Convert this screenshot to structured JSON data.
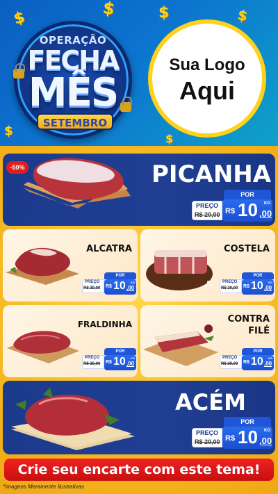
{
  "header": {
    "badge": {
      "line1": "OPERAÇÃO",
      "line2": "FECHA",
      "line3": "MÊS",
      "month": "SETEMBRO"
    },
    "logo": {
      "line1": "Sua Logo",
      "line2": "Aqui"
    },
    "decor_icon": "dollar-sign"
  },
  "colors": {
    "header_blue": "#0a5fc0",
    "card_blue": "#1c3a8c",
    "price_blue": "#1e56d6",
    "accent_yellow": "#ffd21a",
    "cta_red": "#e01e1e"
  },
  "products": [
    {
      "name": "PICANHA",
      "badge": "-50%",
      "por": "POR",
      "preco": "PREÇO",
      "old_price": "R$ 20,00",
      "currency": "R$",
      "price": "10",
      "cents": ",00",
      "unit": "KG"
    },
    {
      "name": "ALCATRA",
      "por": "POR",
      "preco": "PREÇO",
      "old_price": "R$ 20,00",
      "currency": "R$",
      "price": "10",
      "cents": ",00",
      "unit": "KG"
    },
    {
      "name": "COSTELA",
      "por": "POR",
      "preco": "PREÇO",
      "old_price": "R$ 20,00",
      "currency": "R$",
      "price": "10",
      "cents": ",00",
      "unit": "KG"
    },
    {
      "name": "FRALDINHA",
      "por": "POR",
      "preco": "PREÇO",
      "old_price": "R$ 20,00",
      "currency": "R$",
      "price": "10",
      "cents": ",00",
      "unit": "KG"
    },
    {
      "name_line1": "CONTRA",
      "name_line2": "FILÉ",
      "por": "POR",
      "preco": "PREÇO",
      "old_price": "R$ 20,00",
      "currency": "R$",
      "price": "10",
      "cents": ",00",
      "unit": "KG"
    },
    {
      "name": "ACÉM",
      "por": "POR",
      "preco": "PREÇO",
      "old_price": "R$ 20,00",
      "currency": "R$",
      "price": "10",
      "cents": ",00",
      "unit": "KG"
    }
  ],
  "cta": "Crie seu encarte com este tema!",
  "footnote": "*Imagens Meramente Ilustrativas"
}
